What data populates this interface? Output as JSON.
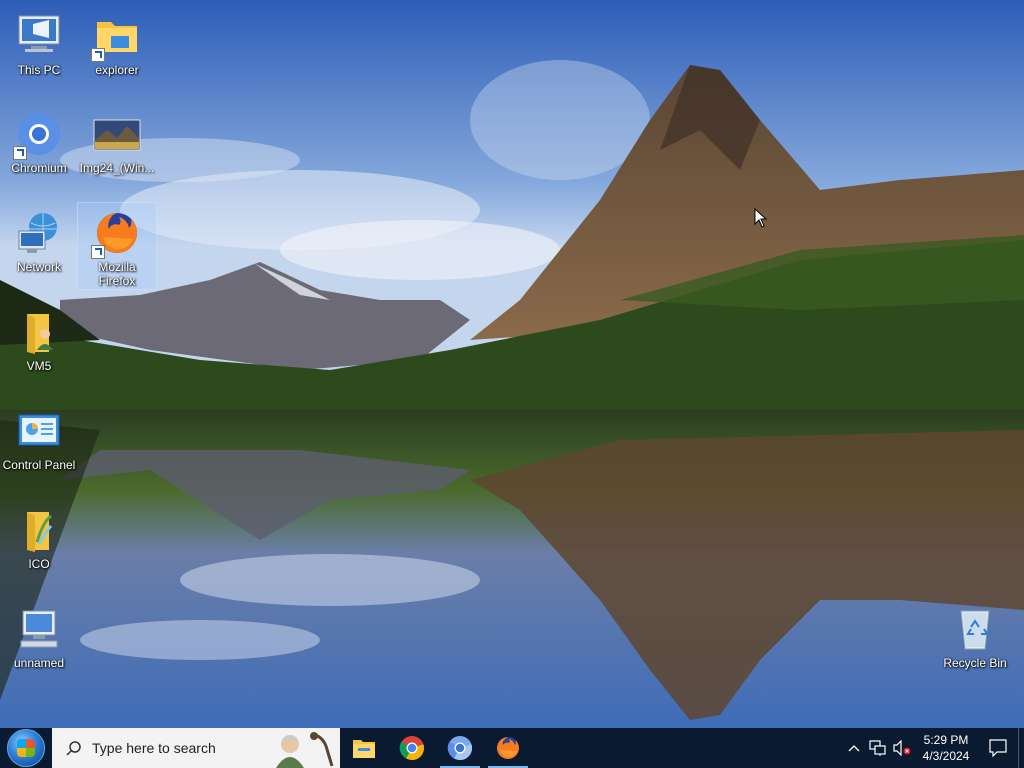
{
  "desktop": {
    "icons": [
      {
        "label": "This PC",
        "icon": "this-pc-icon"
      },
      {
        "label": "explorer",
        "icon": "folder-icon"
      },
      {
        "label": "Chromium",
        "icon": "chromium-icon"
      },
      {
        "label": "Img24_(Win...",
        "icon": "image-file-icon"
      },
      {
        "label": "Network",
        "icon": "network-icon"
      },
      {
        "label": "Mozilla Firefox",
        "icon": "firefox-icon"
      },
      {
        "label": "VM5",
        "icon": "user-folder-icon"
      },
      {
        "label": "Control Panel",
        "icon": "control-panel-icon"
      },
      {
        "label": "ICO",
        "icon": "ico-folder-icon"
      },
      {
        "label": "unnamed",
        "icon": "computer-icon"
      },
      {
        "label": "Recycle Bin",
        "icon": "recycle-bin-icon"
      }
    ]
  },
  "taskbar": {
    "search_placeholder": "Type here to search",
    "apps": [
      {
        "name": "File Explorer",
        "icon": "file-explorer-icon",
        "active": false
      },
      {
        "name": "Google Chrome",
        "icon": "chrome-icon",
        "active": false
      },
      {
        "name": "Chromium",
        "icon": "chromium-icon",
        "active": true
      },
      {
        "name": "Firefox",
        "icon": "firefox-icon",
        "active": true
      }
    ],
    "clock": {
      "time": "5:29 PM",
      "date": "4/3/2024"
    }
  },
  "colors": {
    "taskbar": "#0a1a30",
    "accent": "#76b9ed"
  }
}
